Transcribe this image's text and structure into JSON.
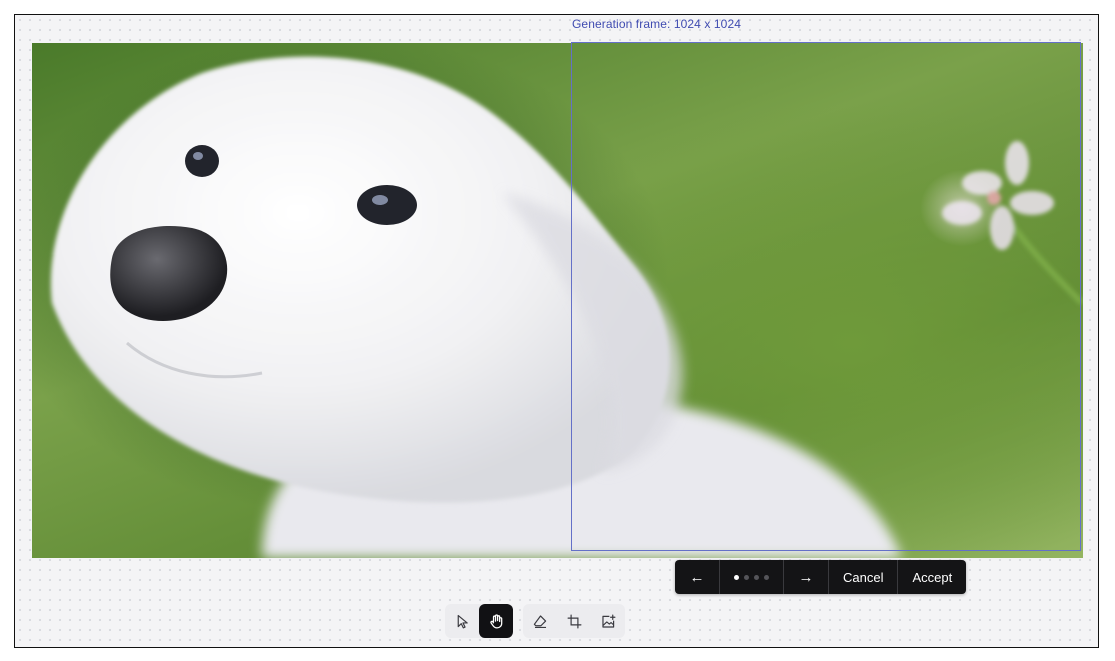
{
  "generation_frame": {
    "label": "Generation frame: 1024 x 1024"
  },
  "variant_bar": {
    "prev_icon": "arrow-left-icon",
    "next_icon": "arrow-right-icon",
    "prev_glyph": "←",
    "next_glyph": "→",
    "variant_count": 4,
    "active_variant": 1,
    "cancel_label": "Cancel",
    "accept_label": "Accept"
  },
  "toolbar": {
    "tools": [
      {
        "name": "select-tool",
        "icon": "cursor-arrow-icon",
        "active": false
      },
      {
        "name": "hand-tool",
        "icon": "hand-icon",
        "active": true
      },
      {
        "name": "eraser-tool",
        "icon": "eraser-icon",
        "active": false
      },
      {
        "name": "frame-tool",
        "icon": "crop-frame-icon",
        "active": false
      },
      {
        "name": "add-image-tool",
        "icon": "add-image-icon",
        "active": false
      }
    ]
  },
  "colors": {
    "frame_border": "#6470c8",
    "frame_label": "#3f4bb0",
    "bar_background": "#141416",
    "active_tool": "#111114"
  }
}
